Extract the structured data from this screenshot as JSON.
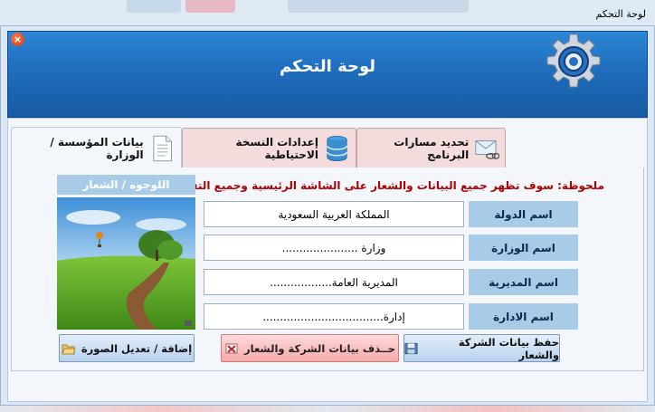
{
  "window": {
    "title": "لوحة التحكم"
  },
  "header": {
    "title": "لوحة التحكم"
  },
  "tabs": [
    {
      "label": "بيانات المؤسسة / الوزارة",
      "icon": "document-icon",
      "active": true
    },
    {
      "label": "إعدادات النسخة الاحتياطية",
      "icon": "database-icon",
      "active": false
    },
    {
      "label": "تحديد مسارات البرنامج",
      "icon": "envelope-link-icon",
      "active": false
    }
  ],
  "form": {
    "note": "ملحوظة: سوف تظهر جميع البيانات والشعار على الشاشة الرئيسية وجميع التقارير",
    "logo_label": "اللوجوه / الشعار",
    "fields": [
      {
        "label": "اسم الدولة",
        "value": "المملكة العربية السعودية"
      },
      {
        "label": "اسم الوزارة",
        "value": "وزارة ......................"
      },
      {
        "label": "اسم المديرية",
        "value": "المديرية العامة.................."
      },
      {
        "label": "اسم الادارة",
        "value": "إدارة..................................."
      }
    ]
  },
  "buttons": {
    "save": "حفظ بيانات الشركة والشعار",
    "delete": "حــذف بيانات الشركة والشعار",
    "image": "إضافة / تعديل الصورة"
  },
  "colors": {
    "accent": "#1f6dbd",
    "label_bg": "#a8cbe8",
    "note": "#b00000",
    "tab_inactive": "#f4dcdc"
  }
}
